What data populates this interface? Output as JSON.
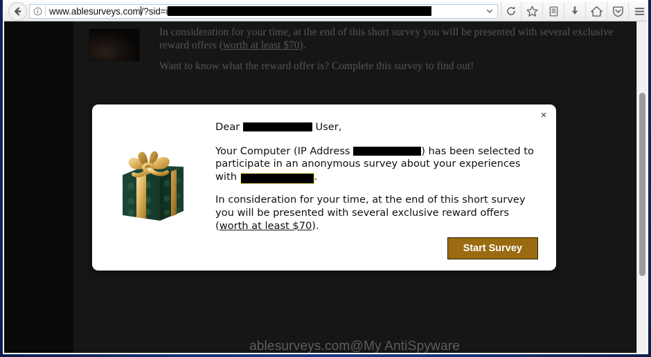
{
  "browser": {
    "back_icon": "back-arrow-icon",
    "identity_icon": "info-circle-icon",
    "url_prefix": "www.ablesurveys.com",
    "url_query": "/?sid=i",
    "url_redacted": true,
    "dropdown_icon": "chevron-down-icon",
    "reload_icon": "reload-icon",
    "toolbar_icons": [
      {
        "name": "bookmark-star-icon",
        "glyph": "star"
      },
      {
        "name": "library-icon",
        "glyph": "library"
      },
      {
        "name": "downloads-icon",
        "glyph": "download"
      },
      {
        "name": "home-icon",
        "glyph": "home"
      },
      {
        "name": "pocket-shield-icon",
        "glyph": "shield"
      },
      {
        "name": "hamburger-menu-icon",
        "glyph": "menu"
      }
    ]
  },
  "page": {
    "thumbnail_alt": "hands-typing-on-keyboard-photo",
    "paragraph_1_a": "In consideration for your time, at the end of this short survey you will be presented with several exclusive reward offers (",
    "paragraph_1_link": "worth at least $70",
    "paragraph_1_b": ").",
    "paragraph_2": "Want to know what the reward offer is? Complete this survey to find out!",
    "watermark": "ablesurveys.com@My AntiSpyware"
  },
  "modal": {
    "close_label": "×",
    "gift_icon": "green-gift-box-with-gold-ribbon",
    "greeting_prefix": "Dear ",
    "greeting_suffix": " User,",
    "body_1_a": "Your Computer (IP Address ",
    "body_1_b": ") has been selected to participate in an anonymous survey about your experiences with ",
    "body_1_c": ".",
    "body_2_a": "In consideration for your time, at the end of this short survey you will be presented with several exclusive reward offers (",
    "body_2_link": "worth at least $70",
    "body_2_b": ").",
    "button_label": "Start Survey"
  },
  "colors": {
    "button_bg": "#9a6b10",
    "button_border": "#2d2009",
    "highlight": "#f3ec5a",
    "redaction": "#000000",
    "page_bg": "#3a3a3a",
    "desktop": "#1b3a8c"
  }
}
